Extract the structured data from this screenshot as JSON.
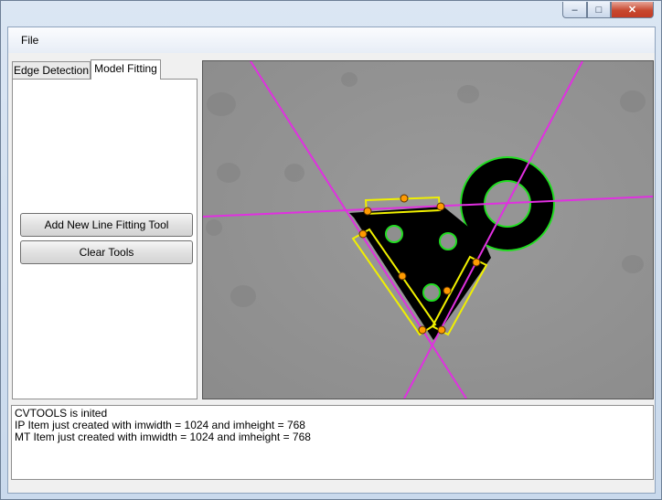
{
  "titlebar": {
    "title": "",
    "minimize_icon": "minimize-icon",
    "maximize_icon": "maximize-icon",
    "close_icon": "close-icon"
  },
  "menu": {
    "items": [
      {
        "label": "File"
      }
    ]
  },
  "tabs": [
    {
      "label": "Edge Detection",
      "active": false
    },
    {
      "label": "Model Fitting",
      "active": true
    }
  ],
  "panel": {
    "buttons": [
      {
        "label": "Add New Line Fitting Tool"
      },
      {
        "label": "Clear Tools"
      }
    ]
  },
  "image_view": {
    "content": "grayscale camera image of a black triangular part with a ring, overlaid with magenta fitted lines and yellow fitting tools",
    "colors": {
      "fit_line": "#e030e0",
      "tool_box": "#f0f000",
      "handle": "#ff9a00",
      "contour": "#20dd20"
    }
  },
  "log": {
    "lines": [
      "CVTOOLS is inited",
      "IP Item just created with imwidth = 1024 and imheight = 768",
      "MT Item just created with imwidth = 1024 and imheight = 768"
    ]
  }
}
